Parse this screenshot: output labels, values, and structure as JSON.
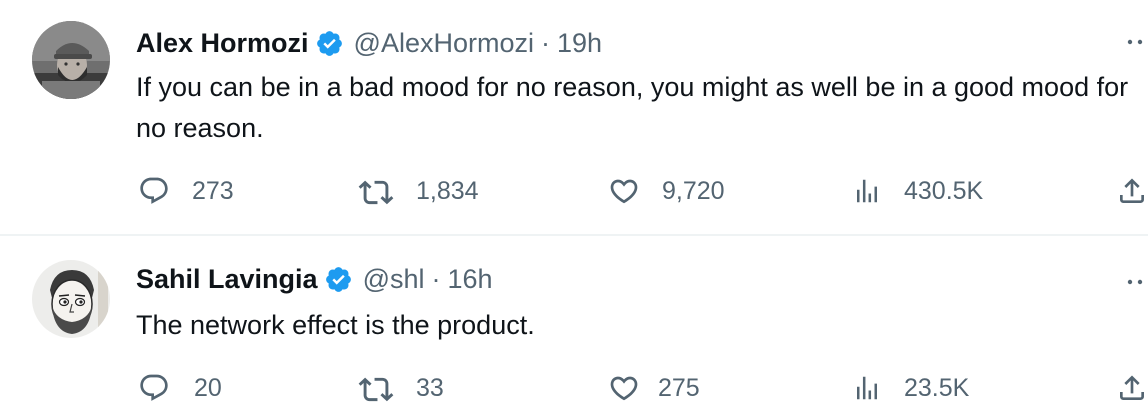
{
  "tweets": [
    {
      "author": {
        "name": "Alex Hormozi",
        "handle": "@AlexHormozi",
        "verified": true,
        "avatar": "bearded-man-with-cap-avatar"
      },
      "separator": "·",
      "time": "19h",
      "text": "If you can be in a bad mood for no reason, you might as well be in a good mood for no reason.",
      "stats": {
        "replies": "273",
        "retweets": "1,834",
        "likes": "9,720",
        "views": "430.5K"
      }
    },
    {
      "author": {
        "name": "Sahil Lavingia",
        "handle": "@shl",
        "verified": true,
        "avatar": "sketched-cartoon-face-avatar"
      },
      "separator": "·",
      "time": "16h",
      "text": "The network effect is the product.",
      "stats": {
        "replies": "20",
        "retweets": "33",
        "likes": "275",
        "views": "23.5K"
      }
    }
  ],
  "icons": {
    "reply": "reply-bubble-icon",
    "retweet": "retweet-arrows-icon",
    "like": "heart-icon",
    "views": "views-bars-icon",
    "share": "share-upload-icon",
    "more": "more-dots-icon",
    "verified": "verified-badge-icon"
  },
  "colors": {
    "text": "#0f1419",
    "secondary": "#536471",
    "verified": "#1d9bf0",
    "divider": "#eff3f4"
  }
}
